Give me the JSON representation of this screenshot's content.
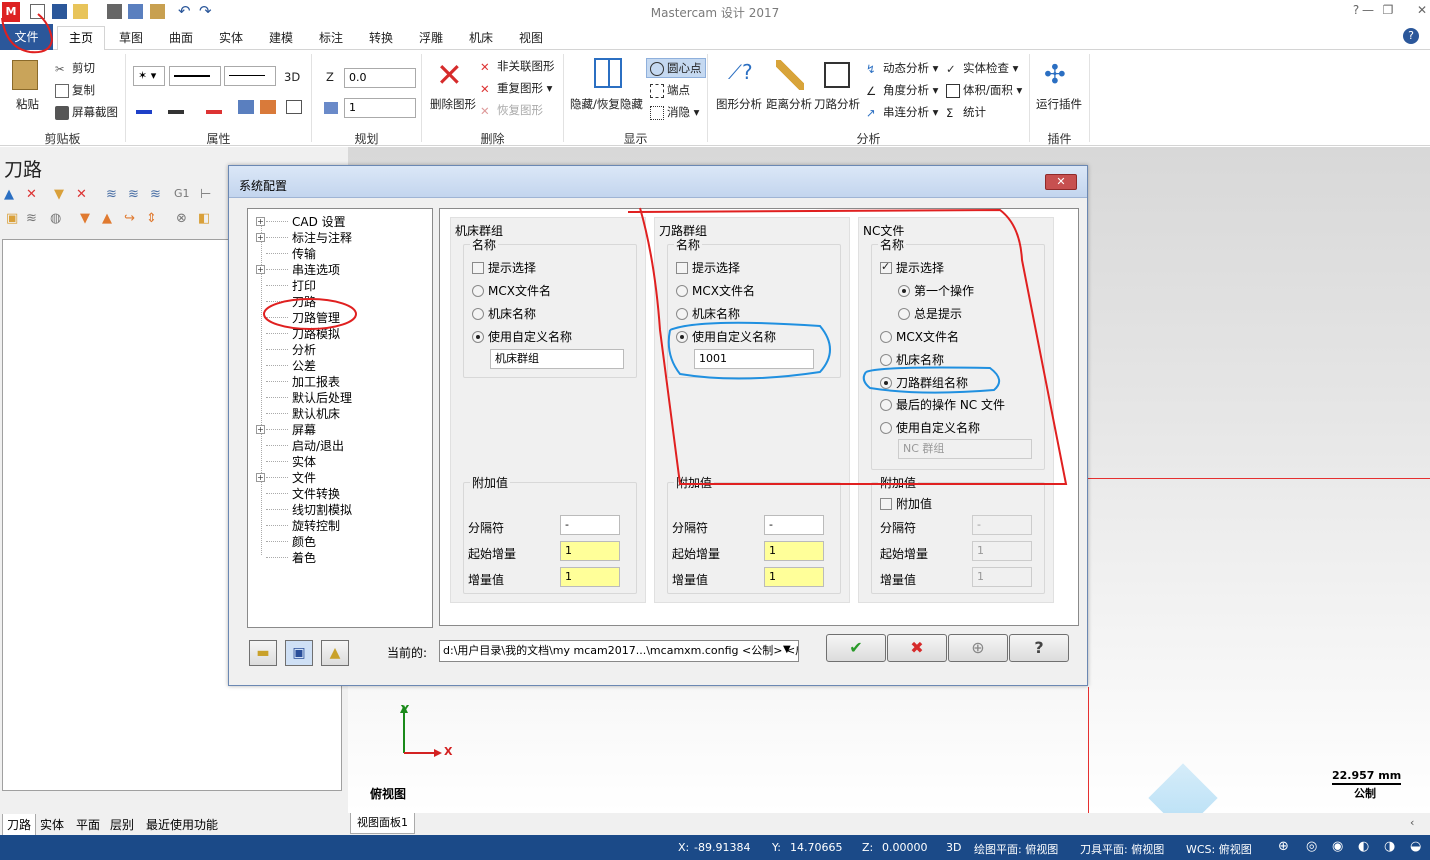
{
  "app": {
    "title": "Mastercam 设计 2017"
  },
  "tabs": {
    "file": "文件",
    "items": [
      "主页",
      "草图",
      "曲面",
      "实体",
      "建模",
      "标注",
      "转换",
      "浮雕",
      "机床",
      "视图"
    ]
  },
  "ribbon": {
    "clipboard": {
      "paste": "粘贴",
      "cut": "剪切",
      "copy": "复制",
      "screenshot": "屏幕截图",
      "label": "剪贴板"
    },
    "attributes": {
      "label": "属性",
      "mode3d": "3D"
    },
    "plan": {
      "label": "规划",
      "z_label": "Z",
      "z_value": "0.0",
      "level_value": "1"
    },
    "delete": {
      "delete_entities": "删除图形",
      "unassoc": "非关联图形",
      "dup": "重复图形",
      "restore": "恢复图形",
      "label": "删除"
    },
    "display": {
      "hide_restore": "隐藏/恢复隐藏",
      "center": "圆心点",
      "endpoints": "端点",
      "blank": "消隐",
      "label": "显示"
    },
    "analysis": {
      "entity": "图形分析",
      "distance": "距离分析",
      "toolpath": "刀路分析",
      "dynamic": "动态分析",
      "angle": "角度分析",
      "chain": "串连分析",
      "solid_check": "实体检查",
      "volume": "体积/面积",
      "stats": "统计",
      "label": "分析"
    },
    "addins": {
      "run": "运行插件",
      "label": "插件"
    }
  },
  "left_panel": {
    "title": "刀路",
    "tabs": [
      "刀路",
      "实体",
      "平面",
      "层别",
      "最近使用功能"
    ]
  },
  "viewport": {
    "view_label": "俯视图",
    "axis_x": "X",
    "axis_y": "Y",
    "scale_value": "22.957 mm",
    "scale_unit": "公制",
    "tab": "视图面板1"
  },
  "statusbar": {
    "x_label": "X:",
    "x_value": "-89.91384",
    "y_label": "Y:",
    "y_value": "14.70665",
    "z_label": "Z:",
    "z_value": "0.00000",
    "mode": "3D",
    "cplane": "绘图平面: 俯视图",
    "tplane": "刀具平面: 俯视图",
    "wcs": "WCS: 俯视图"
  },
  "dialog": {
    "title": "系统配置",
    "tree": [
      "CAD 设置",
      "标注与注释",
      "传输",
      "串连选项",
      "打印",
      "刀路",
      "刀路管理",
      "刀路模拟",
      "分析",
      "公差",
      "加工报表",
      "默认后处理",
      "默认机床",
      "屏幕",
      "启动/退出",
      "实体",
      "文件",
      "文件转换",
      "线切割模拟",
      "旋转控制",
      "颜色",
      "着色"
    ],
    "machine_group": {
      "title": "机床群组",
      "name": "名称",
      "prompt": "提示选择",
      "mcx": "MCX文件名",
      "machine": "机床名称",
      "custom": "使用自定义名称",
      "custom_value": "机床群组"
    },
    "toolpath_group": {
      "title": "刀路群组",
      "name": "名称",
      "prompt": "提示选择",
      "mcx": "MCX文件名",
      "machine": "机床名称",
      "custom": "使用自定义名称",
      "custom_value": "1001"
    },
    "nc_file": {
      "title": "NC文件",
      "name": "名称",
      "prompt": "提示选择",
      "first_op": "第一个操作",
      "always": "总是提示",
      "mcx": "MCX文件名",
      "machine": "机床名称",
      "tp_group": "刀路群组名称",
      "last_op": "最后的操作 NC 文件",
      "custom": "使用自定义名称",
      "custom_value": "NC 群组"
    },
    "addon": {
      "title": "附加值",
      "separator": "分隔符",
      "start": "起始增量",
      "increment": "增量值",
      "sep_value": "-",
      "start_value": "1",
      "inc_value": "1",
      "nc_check": "附加值"
    },
    "current_label": "当前的:",
    "current_path": "d:\\用户目录\\我的文档\\my mcam2017...\\mcamxm.config <公制> <启"
  }
}
